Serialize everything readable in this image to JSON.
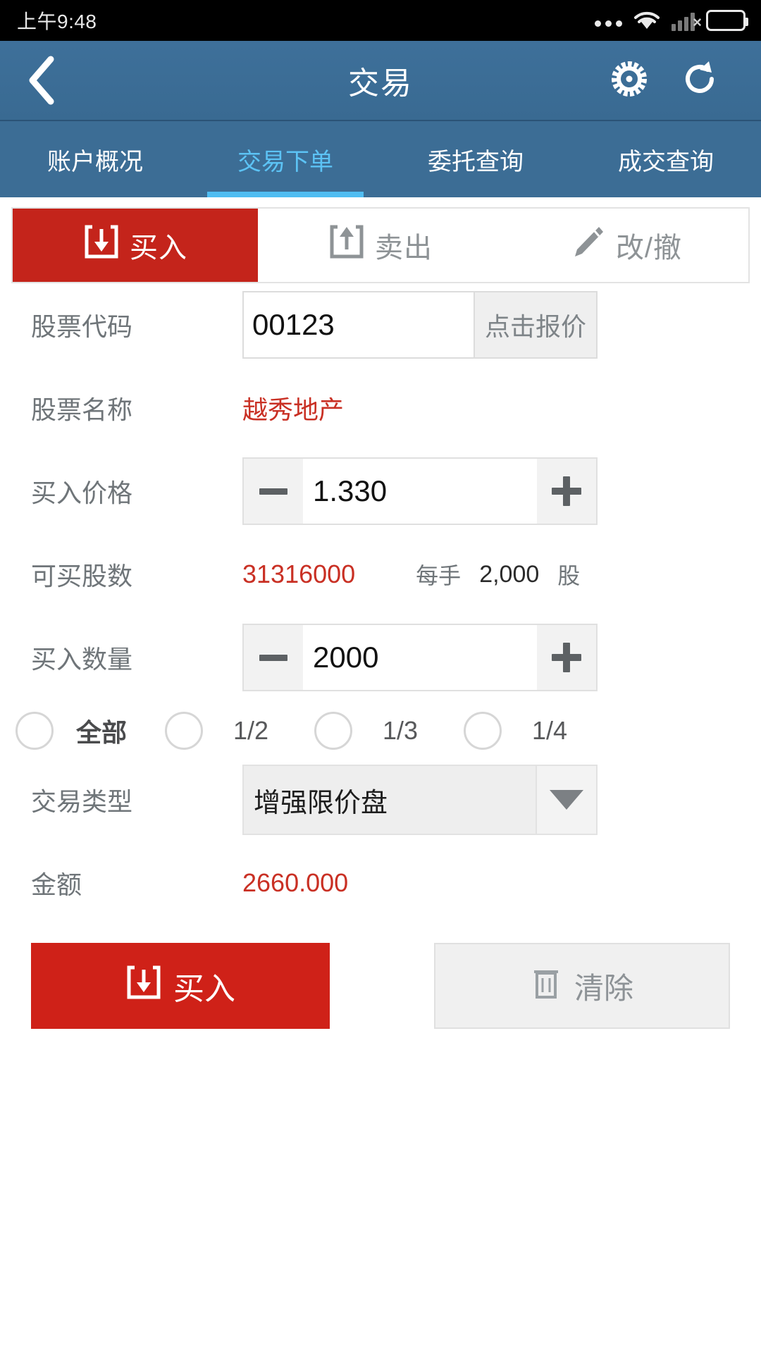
{
  "status_bar": {
    "time": "上午9:48",
    "icons": [
      "more-dots-icon",
      "wifi-icon",
      "signal-none-icon",
      "battery-icon"
    ]
  },
  "header": {
    "back_icon": "chevron-left-icon",
    "title": "交易",
    "settings_icon": "gear-icon",
    "refresh_icon": "refresh-icon"
  },
  "tabs": {
    "active_index": 1,
    "items": [
      {
        "label": "账户概况"
      },
      {
        "label": "交易下单"
      },
      {
        "label": "委托查询"
      },
      {
        "label": "成交查询"
      }
    ],
    "active_color": "#4fbdf2"
  },
  "segments": {
    "active_index": 0,
    "items": [
      {
        "label": "买入",
        "icon": "tray-download-icon"
      },
      {
        "label": "卖出",
        "icon": "tray-upload-icon"
      },
      {
        "label": "改/撤",
        "icon": "pencil-icon"
      }
    ],
    "active_bg": "#c4241b"
  },
  "form": {
    "stock_code": {
      "label": "股票代码",
      "value": "00123",
      "placeholder": "",
      "quote_button": "点击报价"
    },
    "stock_name": {
      "label": "股票名称",
      "value": "越秀地产",
      "color": "#c93024"
    },
    "buy_price": {
      "label": "买入价格",
      "value": "1.330",
      "minus_icon": "minus-icon",
      "plus_icon": "plus-icon"
    },
    "available_shares": {
      "label": "可买股数",
      "value": "31316000",
      "color": "#c93024",
      "lot_label": "每手",
      "lot_size": "2,000",
      "lot_unit": "股"
    },
    "buy_quantity": {
      "label": "买入数量",
      "value": "2000",
      "minus_icon": "minus-icon",
      "plus_icon": "plus-icon"
    },
    "fractions": [
      {
        "label": "全部",
        "selected": false,
        "emphasis": true
      },
      {
        "label": "1/2",
        "selected": false,
        "emphasis": false
      },
      {
        "label": "1/3",
        "selected": false,
        "emphasis": false
      },
      {
        "label": "1/4",
        "selected": false,
        "emphasis": false
      }
    ],
    "order_type": {
      "label": "交易类型",
      "value": "增强限价盘",
      "arrow_icon": "caret-down-icon"
    },
    "amount": {
      "label": "金额",
      "value": "2660.000",
      "color": "#c93024"
    }
  },
  "actions": {
    "buy": {
      "label": "买入",
      "icon": "tray-download-icon",
      "color": "#cf2118"
    },
    "clear": {
      "label": "清除",
      "icon": "trash-icon"
    }
  }
}
